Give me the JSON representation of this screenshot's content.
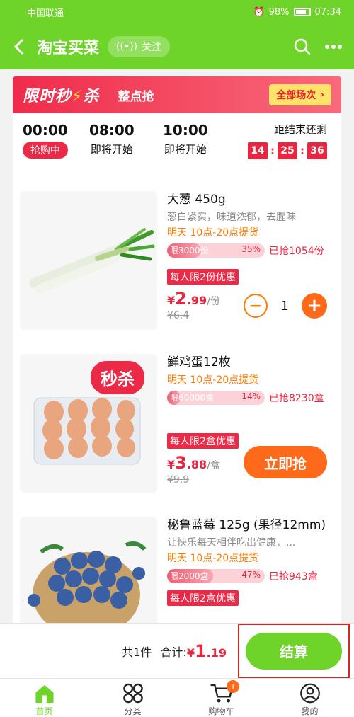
{
  "status_bar": {
    "carrier": "中国联通",
    "battery": "98%",
    "time": "07:34"
  },
  "nav": {
    "title": "淘宝买菜",
    "follow_label": "关注"
  },
  "banner": {
    "logo_prefix": "限时秒",
    "logo_suffix": "杀",
    "subtitle": "整点抢",
    "all_sessions_label": "全部场次"
  },
  "sessions": [
    {
      "time": "00:00",
      "state": "抢购中",
      "active": true
    },
    {
      "time": "08:00",
      "state": "即将开始",
      "active": false
    },
    {
      "time": "10:00",
      "state": "即将开始",
      "active": false
    }
  ],
  "countdown": {
    "label": "距结束还剩",
    "hours": "14",
    "minutes": "25",
    "seconds": "36"
  },
  "products": [
    {
      "title": "大葱 450g",
      "desc": "葱白紧实，味道浓郁，去腥味",
      "pickup": "明天 10点-20点提货",
      "limit_text": "限3000份",
      "progress_percent": 35,
      "progress_label": "35%",
      "sold_text": "已抢1054份",
      "promo_tag": "每人限2份优惠",
      "price_yen": "¥",
      "price_int": "2",
      "price_dec": ".99",
      "price_unit": "/份",
      "original_price": "¥6.4",
      "quantity": "1"
    },
    {
      "title": "鲜鸡蛋12枚",
      "badge": "秒杀",
      "pickup": "明天 10点-20点提货",
      "limit_text": "限60000盒",
      "progress_percent": 14,
      "progress_label": "14%",
      "sold_text": "已抢8230盒",
      "promo_tag": "每人限2盒优惠",
      "price_yen": "¥",
      "price_int": "3",
      "price_dec": ".88",
      "price_unit": "/盒",
      "original_price": "¥9.9",
      "buy_label": "立即抢"
    },
    {
      "title": "秘鲁蓝莓 125g (果径12mm)",
      "desc": "让快乐每天相伴吃出健康，...",
      "pickup": "明天 10点-20点提货",
      "limit_text": "限2000盒",
      "progress_percent": 47,
      "progress_label": "47%",
      "sold_text": "已抢943盒",
      "promo_tag": "每人限2盒优惠"
    }
  ],
  "checkout": {
    "count_text": "共1件",
    "total_label": "合计:",
    "total_yen": "¥",
    "total_int": "1",
    "total_dec": ".19",
    "settle_label": "结算"
  },
  "tabbar": {
    "items": [
      {
        "label": "首页",
        "icon": "home-icon",
        "active": true
      },
      {
        "label": "分类",
        "icon": "category-icon",
        "active": false
      },
      {
        "label": "购物车",
        "icon": "cart-icon",
        "active": false,
        "badge": "1"
      },
      {
        "label": "我的",
        "icon": "user-icon",
        "active": false
      }
    ]
  },
  "colors": {
    "brand_green": "#6fd42a",
    "flash_red": "#ea2a46",
    "orange": "#ff6a1a"
  }
}
